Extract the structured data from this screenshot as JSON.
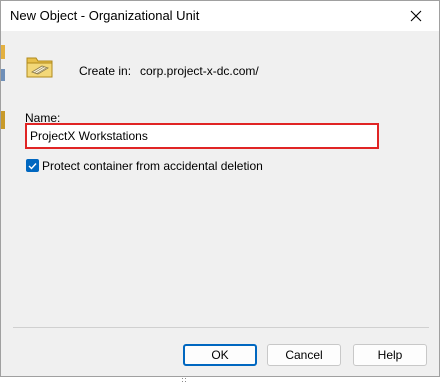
{
  "window": {
    "title": "New Object - Organizational Unit",
    "close_icon": "close-icon"
  },
  "header": {
    "icon": "organizational-unit-folder-icon",
    "create_in_label": "Create in:",
    "create_in_path": "corp.project-x-dc.com/"
  },
  "form": {
    "name_label": "Name:",
    "name_value": "ProjectX Workstations",
    "protect_label": "Protect container from accidental deletion",
    "protect_checked": true
  },
  "buttons": {
    "ok": "OK",
    "cancel": "Cancel",
    "help": "Help"
  },
  "colors": {
    "accent": "#0067c0",
    "highlight_border": "#e02424"
  }
}
